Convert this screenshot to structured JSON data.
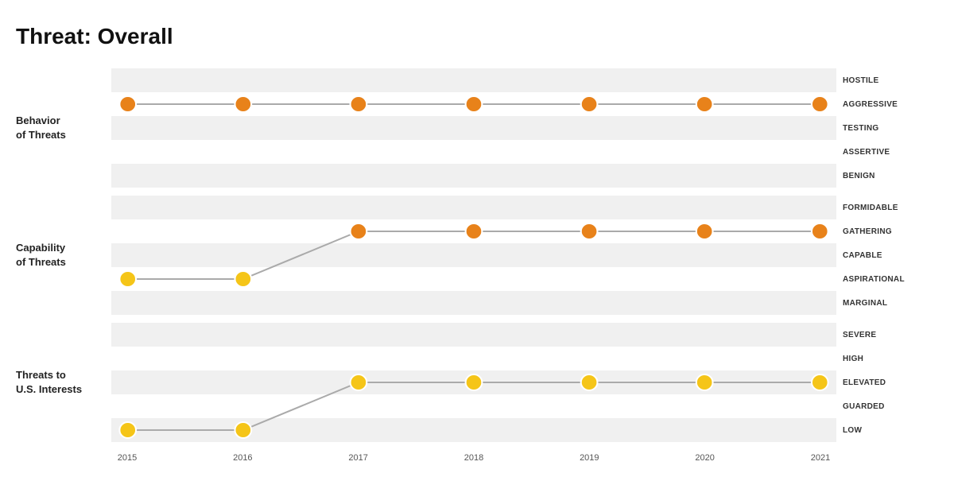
{
  "title": "Threat: Overall",
  "rows": [
    {
      "id": "behavior",
      "label": "Behavior\nof Threats",
      "scale": [
        "HOSTILE",
        "AGGRESSIVE",
        "TESTING",
        "ASSERTIVE",
        "BENIGN"
      ],
      "dataPoints": [
        {
          "year": 2015,
          "level": 1
        },
        {
          "year": 2016,
          "level": 1
        },
        {
          "year": 2017,
          "level": 1
        },
        {
          "year": 2018,
          "level": 1
        },
        {
          "year": 2019,
          "level": 1
        },
        {
          "year": 2020,
          "level": 1
        },
        {
          "year": 2021,
          "level": 1
        }
      ]
    },
    {
      "id": "capability",
      "label": "Capability\nof Threats",
      "scale": [
        "FORMIDABLE",
        "GATHERING",
        "CAPABLE",
        "ASPIRATIONAL",
        "MARGINAL"
      ],
      "dataPoints": [
        {
          "year": 2015,
          "level": 3
        },
        {
          "year": 2016,
          "level": 3
        },
        {
          "year": 2017,
          "level": 1
        },
        {
          "year": 2018,
          "level": 1
        },
        {
          "year": 2019,
          "level": 1
        },
        {
          "year": 2020,
          "level": 1
        },
        {
          "year": 2021,
          "level": 1
        }
      ]
    },
    {
      "id": "threats-us",
      "label": "Threats to\nU.S. Interests",
      "scale": [
        "SEVERE",
        "HIGH",
        "ELEVATED",
        "GUARDED",
        "LOW"
      ],
      "dataPoints": [
        {
          "year": 2015,
          "level": 4
        },
        {
          "year": 2016,
          "level": 4
        },
        {
          "year": 2017,
          "level": 2
        },
        {
          "year": 2018,
          "level": 2
        },
        {
          "year": 2019,
          "level": 2
        },
        {
          "year": 2020,
          "level": 2
        },
        {
          "year": 2021,
          "level": 2
        }
      ]
    }
  ],
  "years": [
    2015,
    2016,
    2017,
    2018,
    2019,
    2020,
    2021
  ]
}
